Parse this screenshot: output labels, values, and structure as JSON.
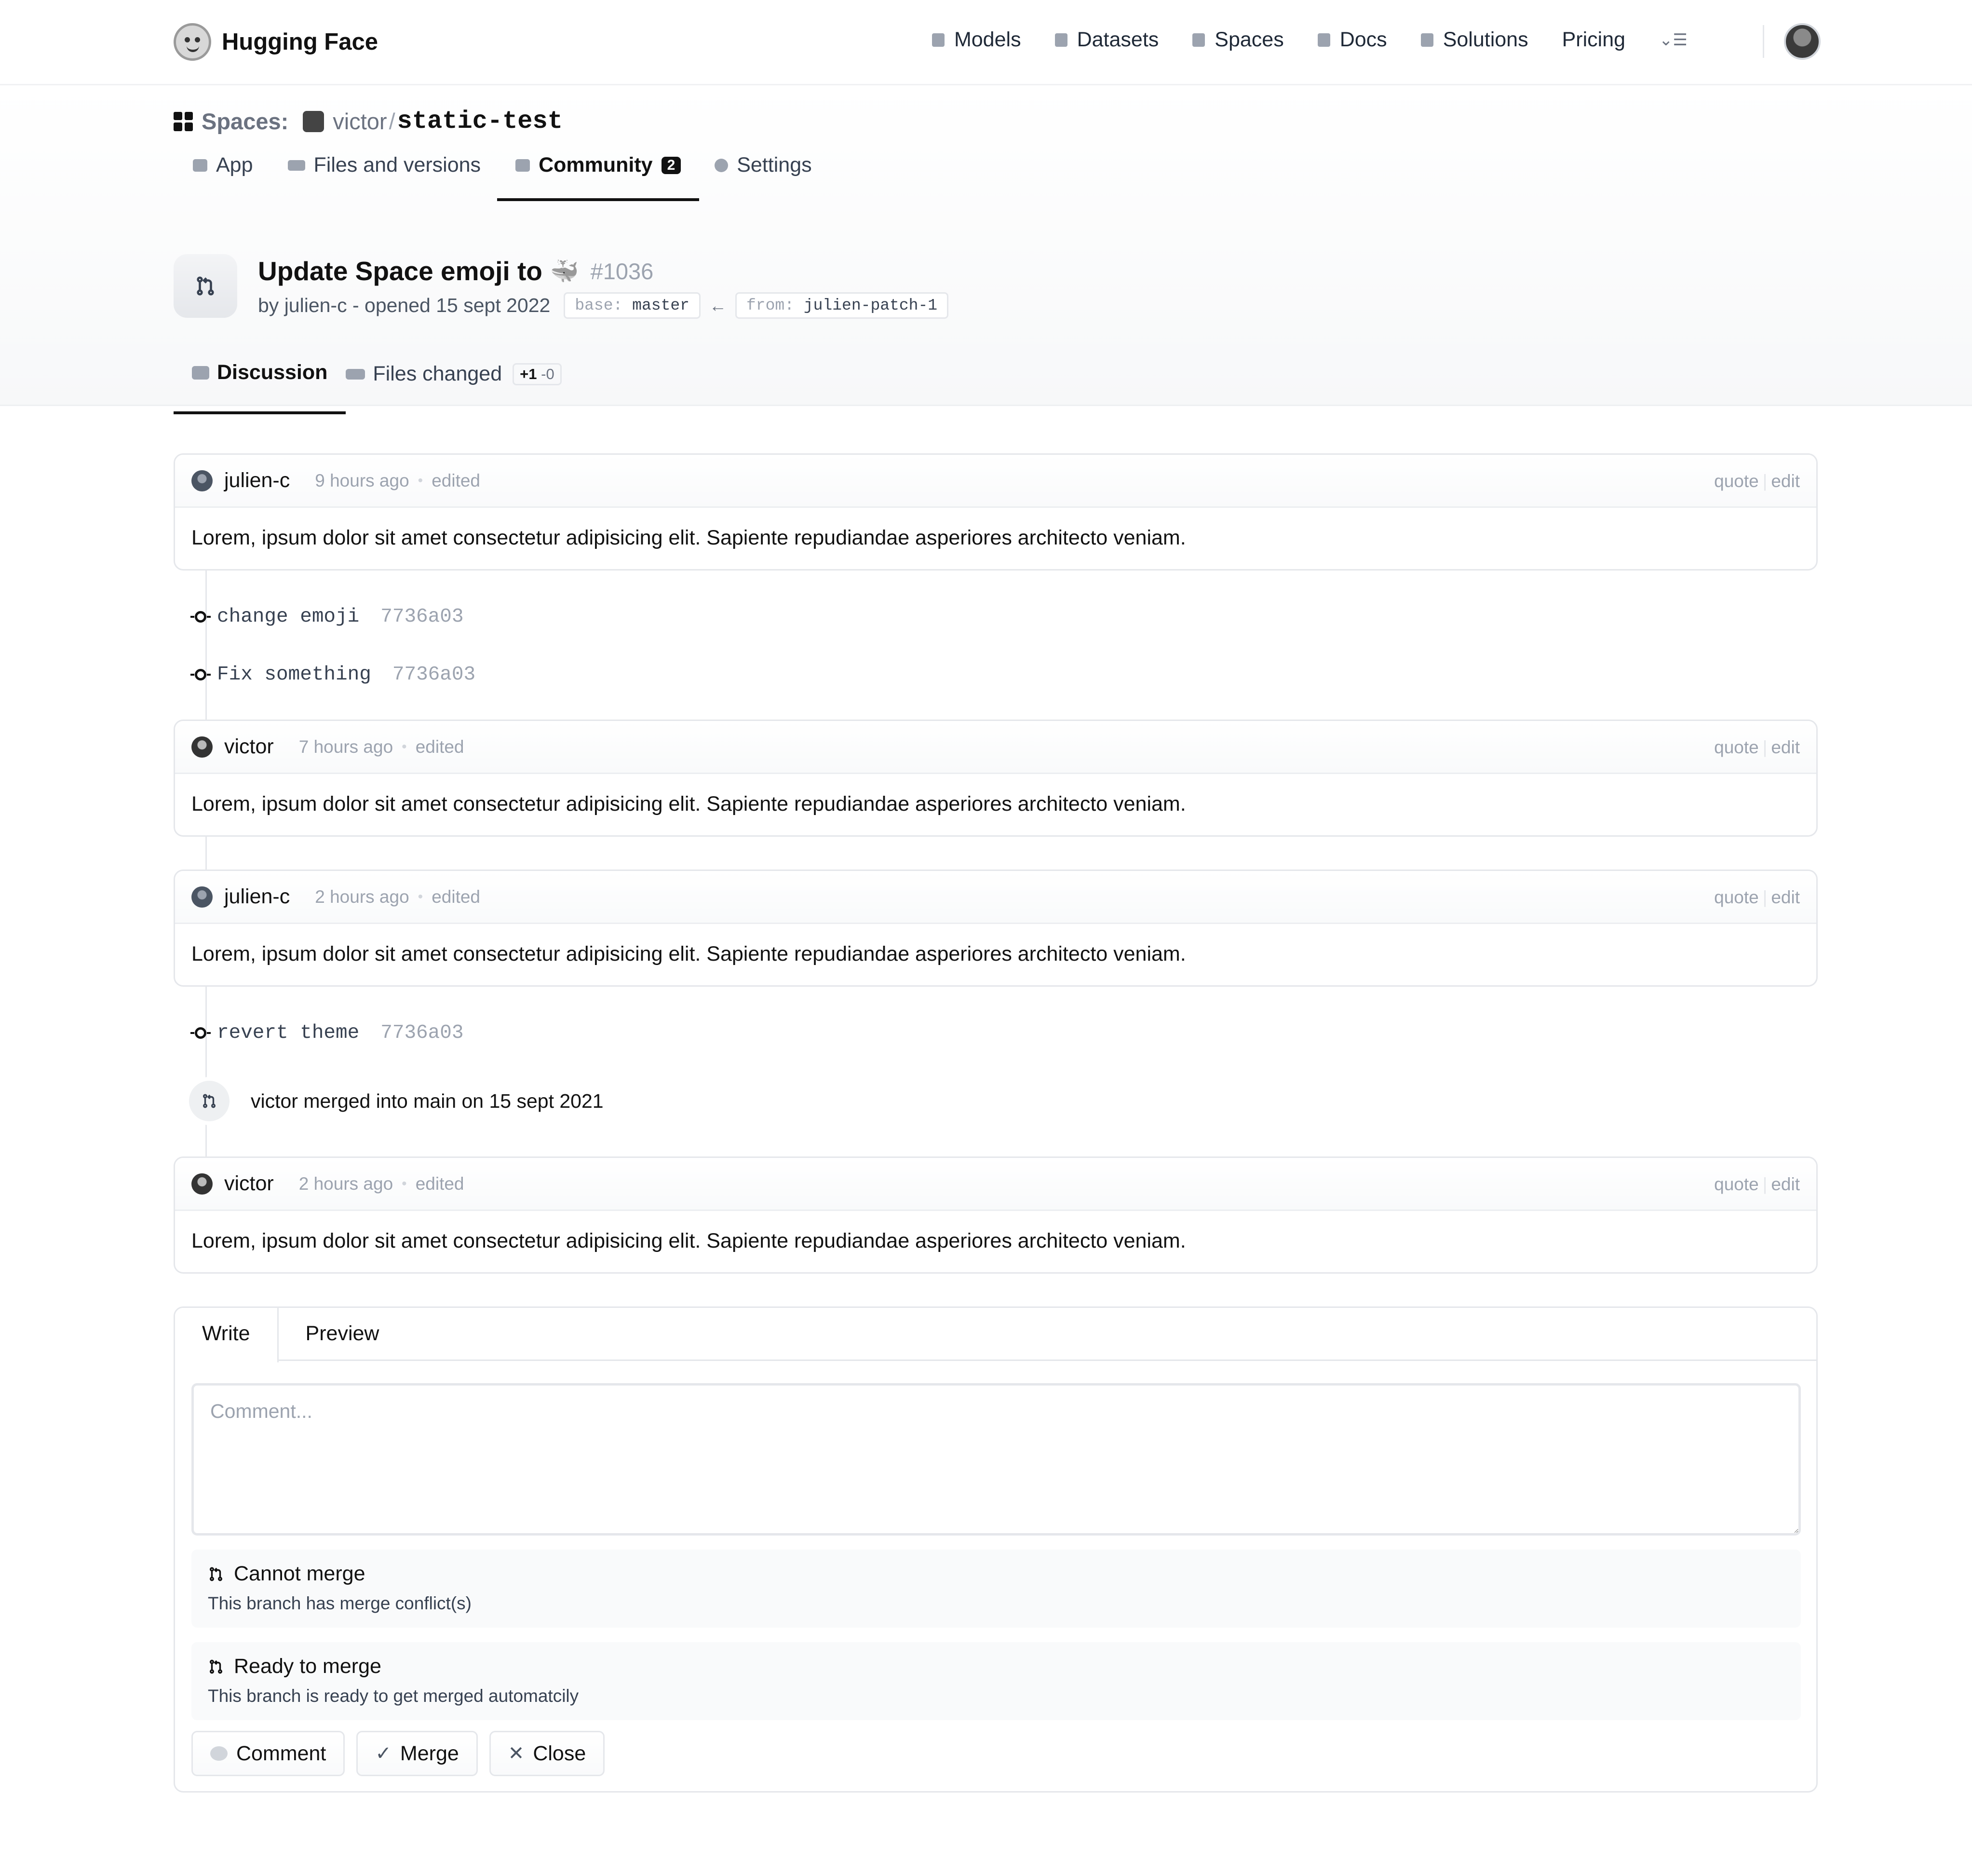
{
  "nav": {
    "brand": "Hugging Face",
    "links": [
      "Models",
      "Datasets",
      "Spaces",
      "Docs",
      "Solutions",
      "Pricing"
    ],
    "more_icon": "menu-icon"
  },
  "breadcrumb": {
    "section": "Spaces:",
    "user": "victor",
    "separator": "/",
    "repo": "static-test"
  },
  "repo_tabs": [
    {
      "label": "App"
    },
    {
      "label": "Files and versions"
    },
    {
      "label": "Community",
      "badge": "2"
    },
    {
      "label": "Settings"
    }
  ],
  "pr": {
    "title": "Update Space emoji to",
    "emoji": "🐳",
    "number": "#1036",
    "meta": "by julien-c - opened 15 sept 2022",
    "base_key": "base:",
    "base_value": "master",
    "arrow": "←",
    "from_key": "from:",
    "from_value": "julien-patch-1"
  },
  "pr_tabs": {
    "discussion": "Discussion",
    "files_changed": "Files changed",
    "additions": "+1",
    "deletions": "-0"
  },
  "comments": [
    {
      "user": "julien-c",
      "time": "9 hours ago",
      "edited": "edited",
      "quote": "quote",
      "edit": "edit",
      "body": "Lorem, ipsum dolor sit amet consectetur adipisicing elit. Sapiente repudiandae asperiores architecto veniam."
    },
    {
      "user": "victor",
      "time": "7 hours ago",
      "edited": "edited",
      "quote": "quote",
      "edit": "edit",
      "body": "Lorem, ipsum dolor sit amet consectetur adipisicing elit. Sapiente repudiandae asperiores architecto veniam."
    },
    {
      "user": "julien-c",
      "time": "2 hours ago",
      "edited": "edited",
      "quote": "quote",
      "edit": "edit",
      "body": "Lorem, ipsum dolor sit amet consectetur adipisicing elit. Sapiente repudiandae asperiores architecto veniam."
    },
    {
      "user": "victor",
      "time": "2 hours ago",
      "edited": "edited",
      "quote": "quote",
      "edit": "edit",
      "body": "Lorem, ipsum dolor sit amet consectetur adipisicing elit. Sapiente repudiandae asperiores architecto veniam."
    }
  ],
  "commits": [
    {
      "message": "change emoji",
      "sha": "7736a03"
    },
    {
      "message": "Fix something",
      "sha": "7736a03"
    },
    {
      "message": "revert theme",
      "sha": "7736a03"
    }
  ],
  "merge_event": "victor merged into main on 15 sept 2021",
  "composer": {
    "tab_write": "Write",
    "tab_preview": "Preview",
    "placeholder": "Comment...",
    "status_blocked_title": "Cannot merge",
    "status_blocked_sub": "This branch has merge conflict(s)",
    "status_ready_title": "Ready to merge",
    "status_ready_sub": "This branch is ready to get merged automatcily",
    "btn_comment": "Comment",
    "btn_merge": "Merge",
    "btn_close": "Close"
  }
}
